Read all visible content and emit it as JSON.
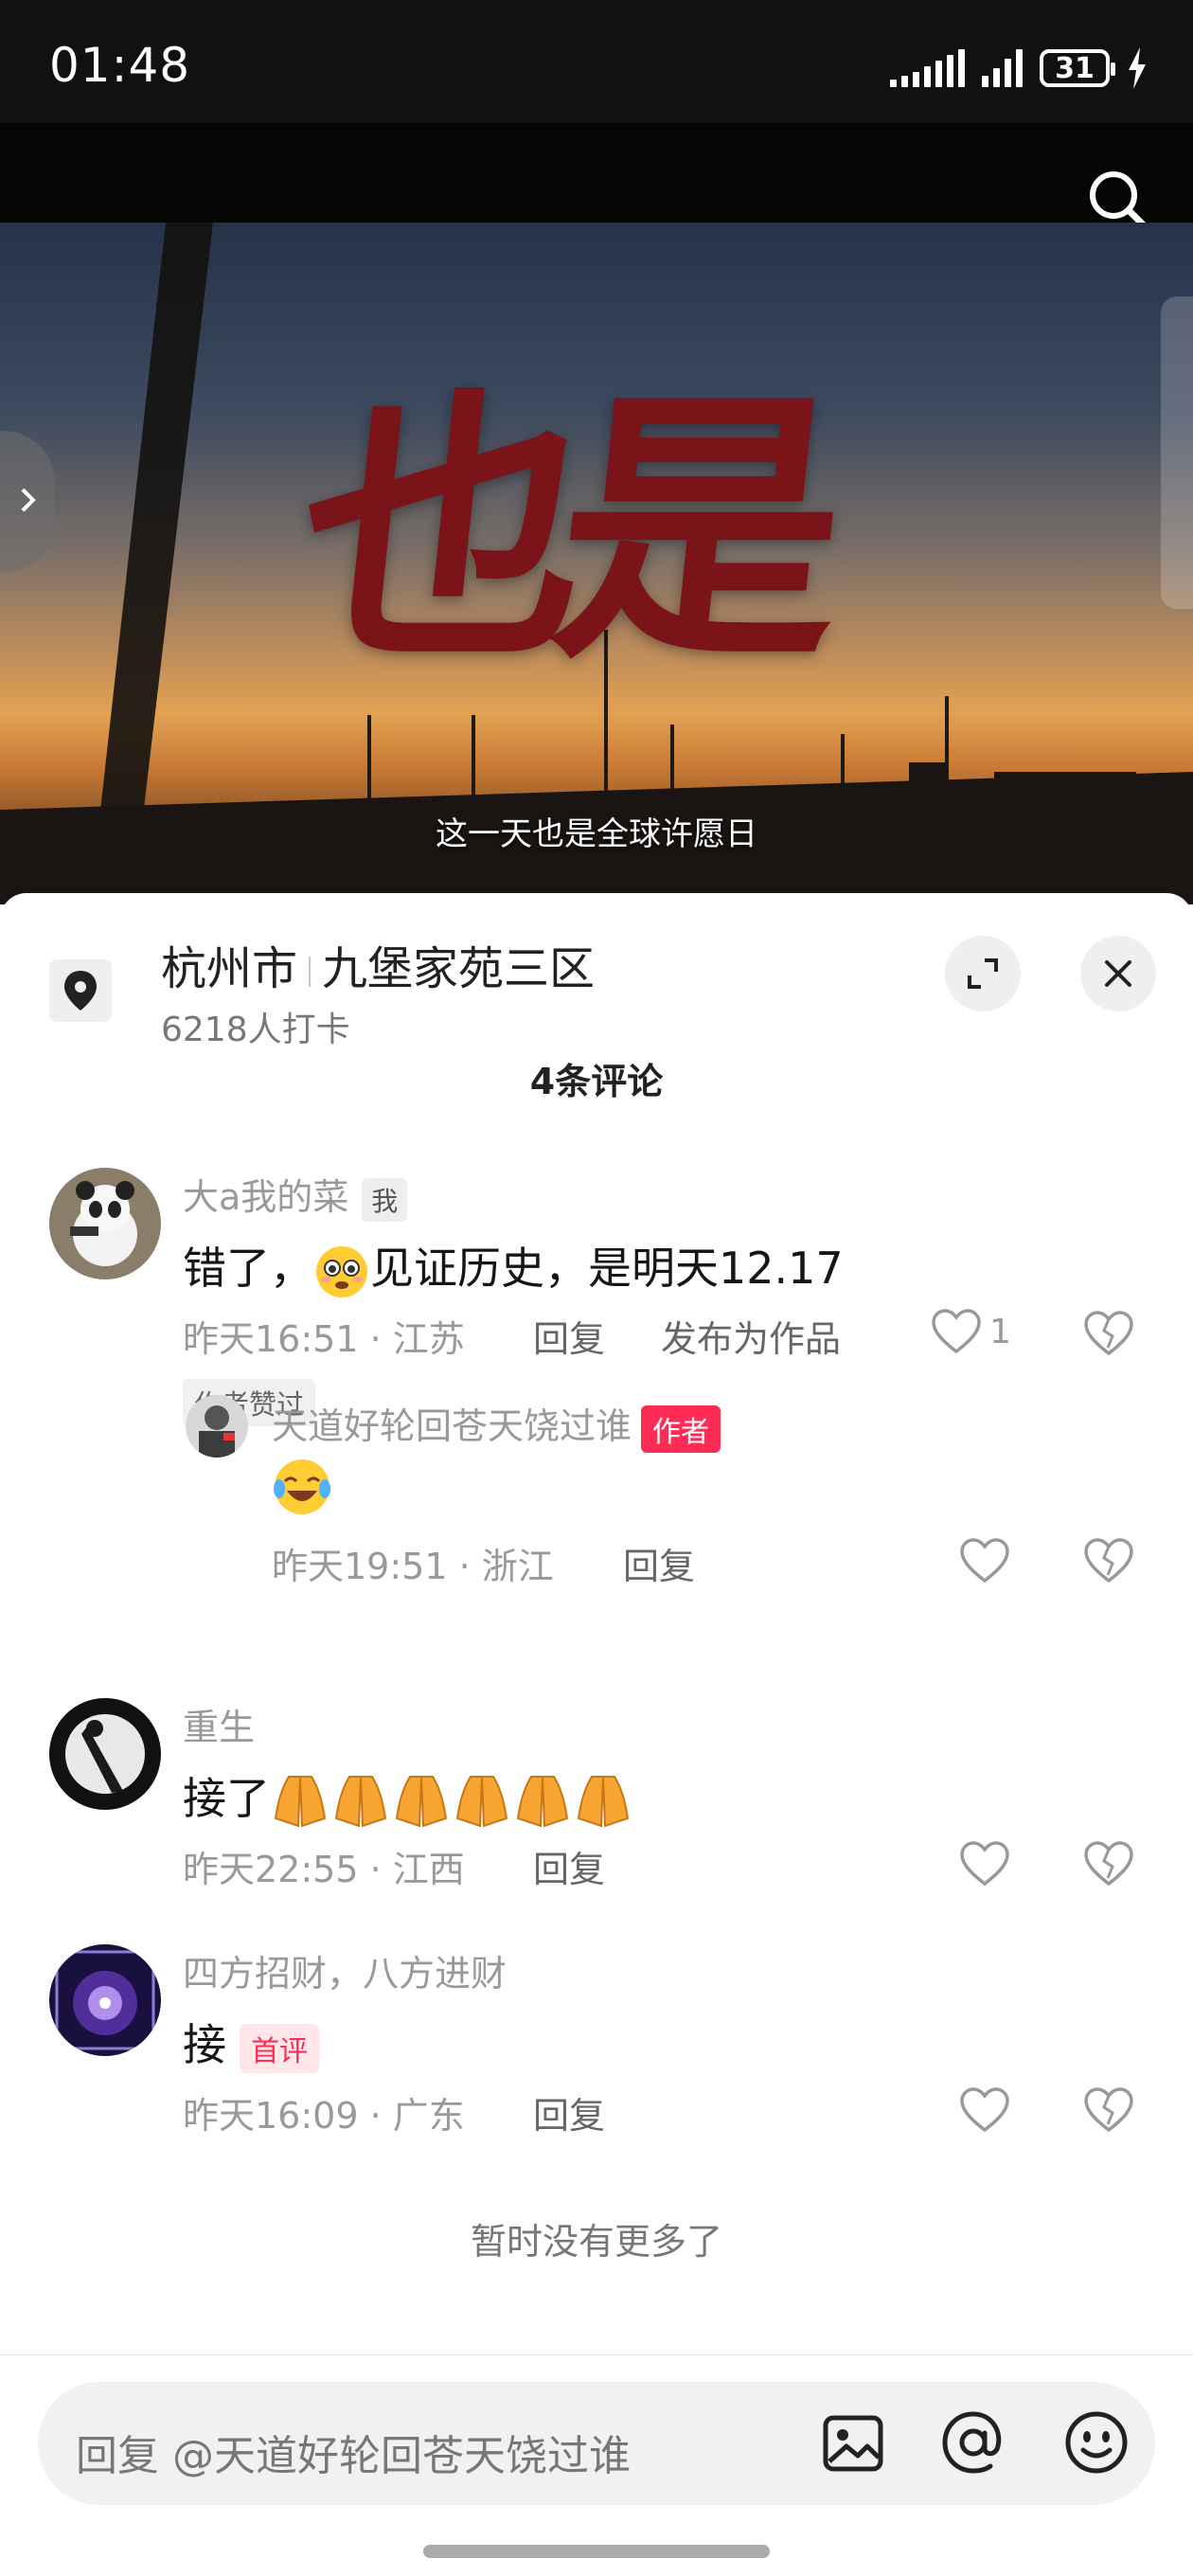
{
  "status_bar": {
    "time": "01:48",
    "battery": "31"
  },
  "video": {
    "title_text": "也是",
    "subtitle": "这一天也是全球许愿日"
  },
  "location": {
    "city": "杭州市",
    "place": "九堡家苑三区",
    "checkins": "6218人打卡"
  },
  "comments_count": "4条评论",
  "comments": [
    {
      "user": "大a我的菜",
      "me_tag": "我",
      "text_before": "错了，",
      "text_after": "见证历史，是明天12.17",
      "time": "昨天16:51",
      "region": "江苏",
      "reply_label": "回复",
      "publish_label": "发布为作品",
      "likes": "1",
      "author_liked": "作者赞过",
      "reply": {
        "user": "天道好轮回苍天饶过谁",
        "author_tag": "作者",
        "time": "昨天19:51",
        "region": "浙江",
        "reply_label": "回复"
      }
    },
    {
      "user": "重生",
      "text": "接了",
      "time": "昨天22:55",
      "region": "江西",
      "reply_label": "回复"
    },
    {
      "user": "四方招财，八方进财",
      "text": "接",
      "first_tag": "首评",
      "time": "昨天16:09",
      "region": "广东",
      "reply_label": "回复"
    }
  ],
  "end_text": "暂时没有更多了",
  "input": {
    "placeholder": "回复 @天道好轮回苍天饶过谁"
  },
  "colors": {
    "accent": "#fe2c55",
    "text_primary": "#161616",
    "text_secondary": "#999999",
    "video_title": "#7a1418"
  },
  "icons": [
    "search-icon",
    "location-pin-icon",
    "expand-icon",
    "close-icon",
    "heart-icon",
    "dislike-heart-icon",
    "image-icon",
    "at-icon",
    "emoji-icon",
    "chevron-right-icon"
  ]
}
